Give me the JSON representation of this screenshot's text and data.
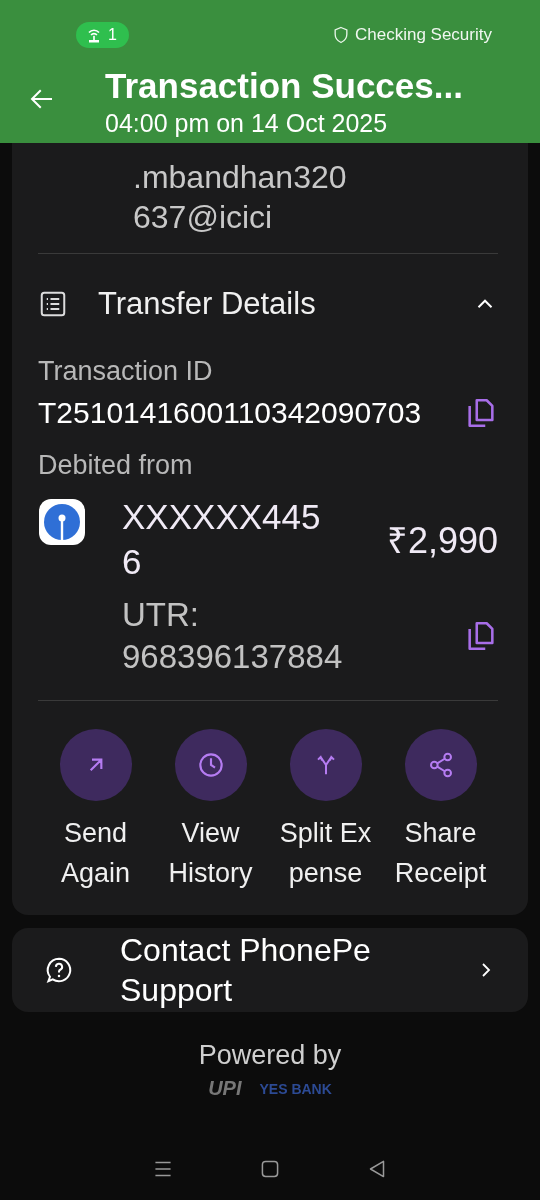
{
  "status_bar": {
    "hotspot_count": "1",
    "security": "Checking Security"
  },
  "header": {
    "title": "Transaction Succes...",
    "subtitle": "04:00 pm on 14 Oct 2025"
  },
  "upi_id": ".mbandhan320637@icici",
  "transfer_details": {
    "title": "Transfer Details",
    "expanded": true,
    "transaction_id_label": "Transaction ID",
    "transaction_id": "T2510141600110342090703",
    "debited_label": "Debited from",
    "account": "XXXXXX4456",
    "amount": "₹2,990",
    "utr_label": "UTR:",
    "utr": "968396137884"
  },
  "actions": [
    {
      "label": "Send Again",
      "kind": "send"
    },
    {
      "label": "View History",
      "kind": "history"
    },
    {
      "label": "Split Ex pense",
      "kind": "split"
    },
    {
      "label": "Share Receipt",
      "kind": "share"
    }
  ],
  "support": {
    "label": "Contact PhonePe Support"
  },
  "footer": {
    "powered_by": "Powered by",
    "upi": "UPI",
    "bank": "YES BANK"
  }
}
